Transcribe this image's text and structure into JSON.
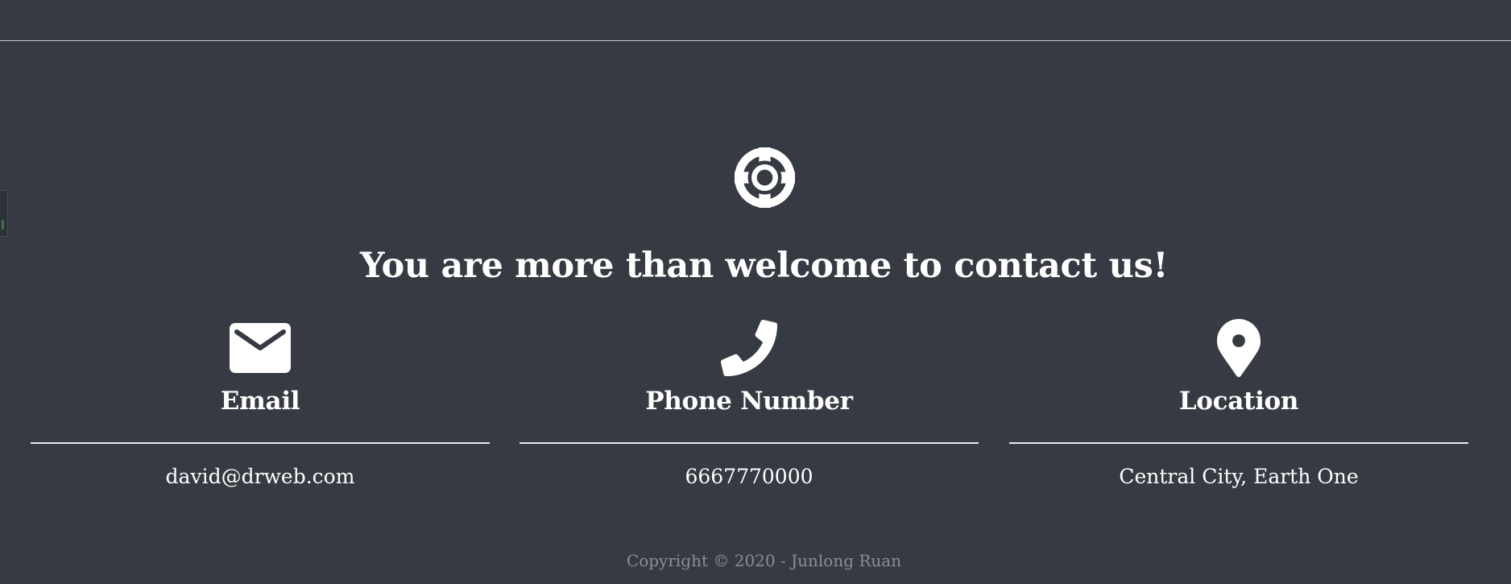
{
  "contact": {
    "title": "You are more than welcome to contact us!",
    "icon": "life-ring-icon",
    "items": [
      {
        "icon": "envelope-icon",
        "label": "Email",
        "value": "david@drweb.com"
      },
      {
        "icon": "phone-icon",
        "label": "Phone Number",
        "value": "6667770000"
      },
      {
        "icon": "map-marker-icon",
        "label": "Location",
        "value": "Central City, Earth One"
      }
    ]
  },
  "footer": {
    "copyright": "Copyright © 2020 - Junlong Ruan"
  },
  "colors": {
    "background": "#363a42",
    "text": "#ffffff",
    "muted": "#8a8e96"
  }
}
